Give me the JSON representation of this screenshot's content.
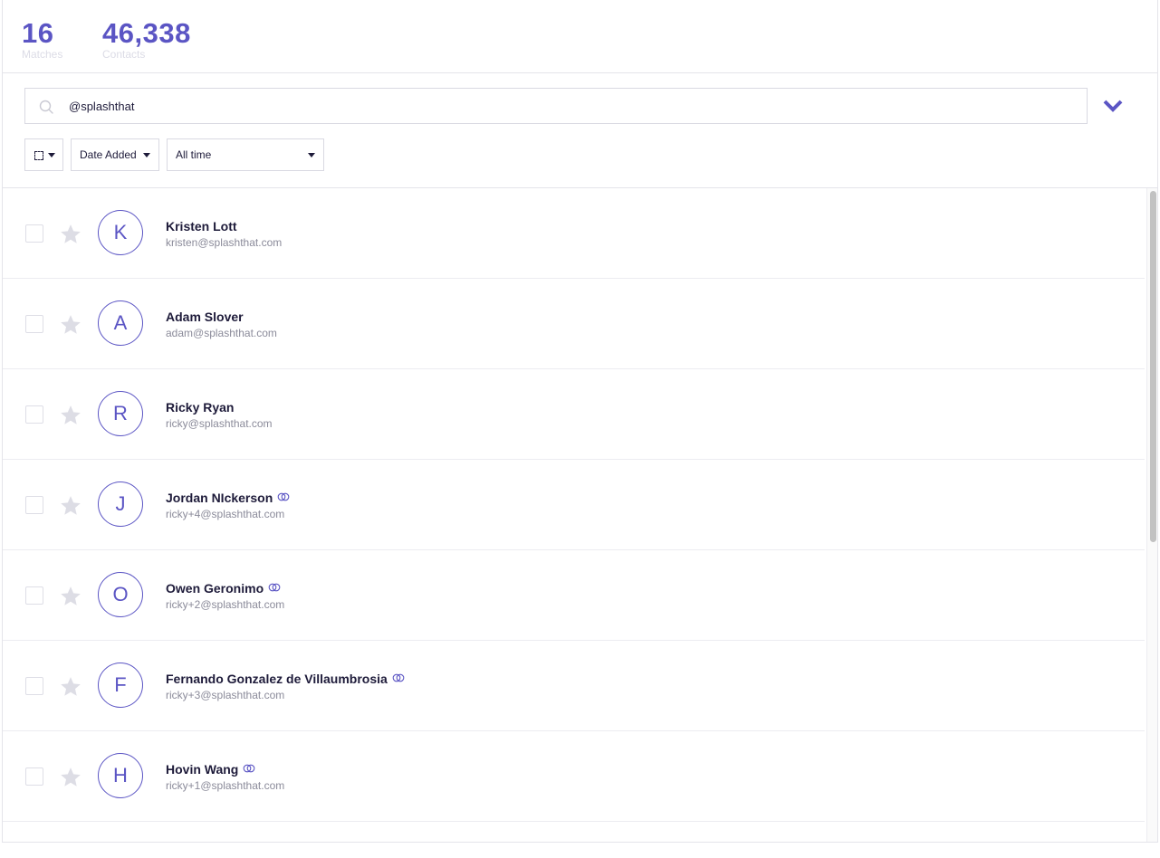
{
  "stats": {
    "matches_count": "16",
    "matches_label": "Matches",
    "contacts_count": "46,338",
    "contacts_label": "Contacts"
  },
  "search": {
    "value": "@splashthat"
  },
  "filters": {
    "sort_label": "Date Added",
    "range_label": "All time"
  },
  "contacts": [
    {
      "initial": "K",
      "name": "Kristen Lott",
      "email": "kristen@splashthat.com",
      "linked": false
    },
    {
      "initial": "A",
      "name": "Adam Slover",
      "email": "adam@splashthat.com",
      "linked": false
    },
    {
      "initial": "R",
      "name": "Ricky Ryan",
      "email": "ricky@splashthat.com",
      "linked": false
    },
    {
      "initial": "J",
      "name": "Jordan NIckerson",
      "email": "ricky+4@splashthat.com",
      "linked": true
    },
    {
      "initial": "O",
      "name": "Owen Geronimo",
      "email": "ricky+2@splashthat.com",
      "linked": true
    },
    {
      "initial": "F",
      "name": "Fernando Gonzalez de Villaumbrosia",
      "email": "ricky+3@splashthat.com",
      "linked": true
    },
    {
      "initial": "H",
      "name": "Hovin Wang",
      "email": "ricky+1@splashthat.com",
      "linked": true
    }
  ],
  "colors": {
    "accent": "#5b55c4",
    "star": "#dddde5",
    "text": "#1e1b3a",
    "muted": "#8b8b9a"
  }
}
